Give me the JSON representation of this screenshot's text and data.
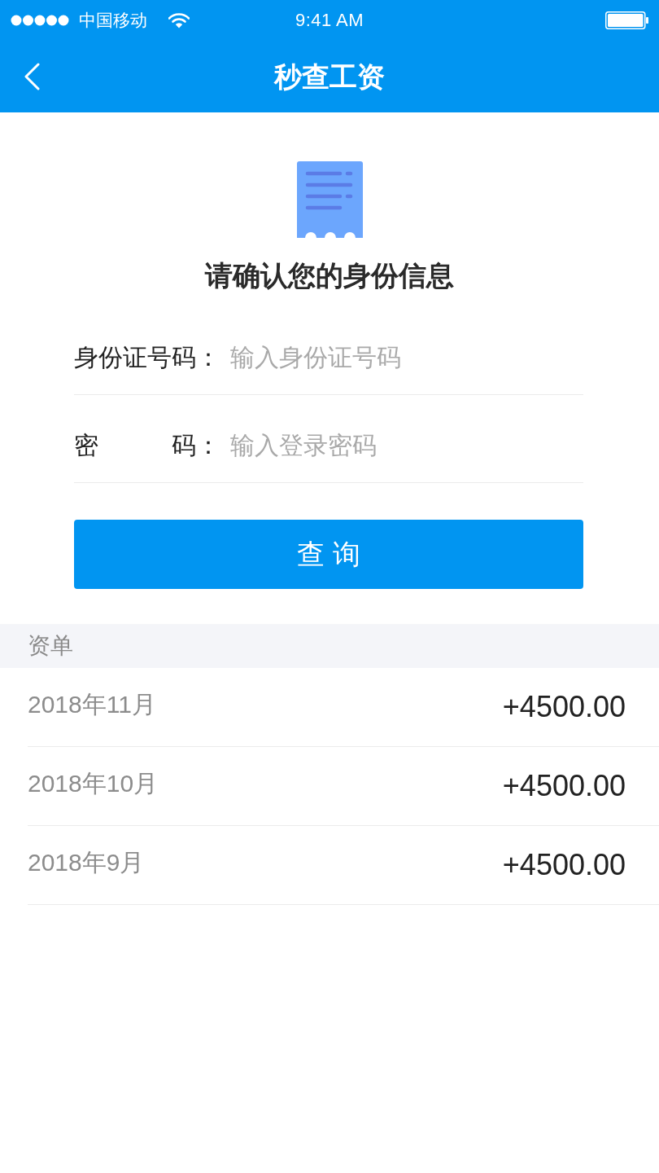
{
  "status_bar": {
    "carrier": "中国移动",
    "time": "9:41 AM"
  },
  "nav_bar": {
    "title": "秒查工资"
  },
  "form": {
    "heading": "请确认您的身份信息",
    "fields": [
      {
        "label": "身份证号码：",
        "placeholder": "输入身份证号码"
      },
      {
        "label": "密　　　码：",
        "placeholder": "输入登录密码"
      }
    ],
    "submit_button": "查 询"
  },
  "bills": {
    "header": "资单",
    "rows": [
      {
        "month": "2018年11月",
        "amount": "+4500.00"
      },
      {
        "month": "2018年10月",
        "amount": "+4500.00"
      },
      {
        "month": "2018年9月",
        "amount": "+4500.00"
      }
    ]
  }
}
